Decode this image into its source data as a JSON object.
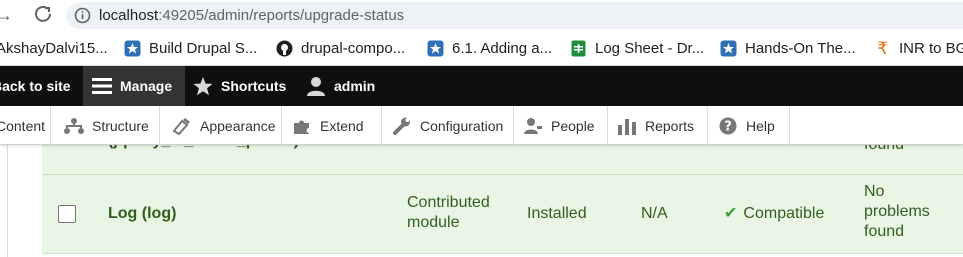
{
  "browser": {
    "url_host": "localhost",
    "url_rest": ":49205/admin/reports/upgrade-status",
    "bookmarks": [
      {
        "label": "AkshayDalvi15...",
        "icon": "none"
      },
      {
        "label": "Build Drupal S...",
        "icon": "drupal-icon"
      },
      {
        "label": "drupal-compo...",
        "icon": "github-icon"
      },
      {
        "label": "6.1. Adding a...",
        "icon": "drupal-icon"
      },
      {
        "label": "Log Sheet - Dr...",
        "icon": "sheets-icon"
      },
      {
        "label": "Hands-On The...",
        "icon": "drupal-icon"
      },
      {
        "label": "INR to BG",
        "icon": "rupee-icon"
      }
    ]
  },
  "toolbar": {
    "back": "Back to site",
    "manage": "Manage",
    "shortcuts": "Shortcuts",
    "user": "admin"
  },
  "tray": {
    "content": "Content",
    "structure": "Structure",
    "appearance": "Appearance",
    "extend": "Extend",
    "configuration": "Configuration",
    "people": "People",
    "reports": "Reports",
    "help": "Help"
  },
  "rows": [
    {
      "name": "(jquery_ui_touch_punch)",
      "type_line": "module",
      "result_line": "found"
    },
    {
      "name": "Log (log)",
      "type_line1": "Contributed",
      "type_line2": "module",
      "status": "Installed",
      "version": "N/A",
      "compat": "Compatible",
      "result_line1": "No",
      "result_line2": "problems",
      "result_line3": "found"
    }
  ],
  "colors": {
    "toolbar_bg": "#0f0f0f",
    "row_bg": "#e9f6e6",
    "row_text": "#325e1c",
    "check": "#3c9d3c"
  }
}
